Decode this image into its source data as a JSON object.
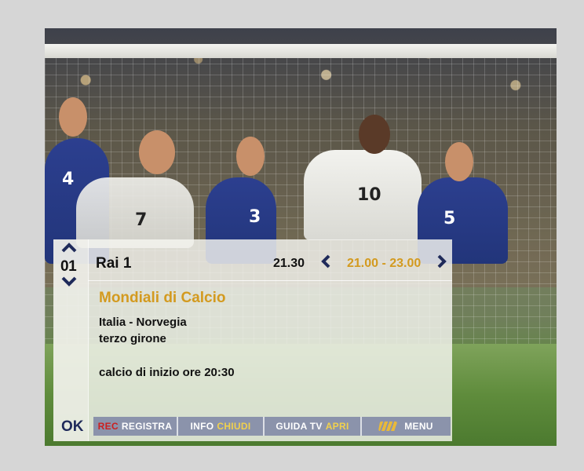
{
  "channel": {
    "number": "01",
    "name": "Rai 1"
  },
  "timing": {
    "current_time": "21.30",
    "slot": "21.00 - 23.00"
  },
  "program": {
    "title": "Mondiali di Calcio",
    "subtitle_1": "Italia - Norvegia",
    "subtitle_2": "terzo girone",
    "note": "calcio di inizio ore 20:30"
  },
  "controls": {
    "ok": "OK",
    "rec_key": "REC",
    "rec_label": "REGISTRA",
    "info_key": "INFO",
    "info_label": "CHIUDI",
    "guide_key": "GUIDA TV",
    "guide_label": "APRI",
    "menu_label": "MENU"
  },
  "players": {
    "jersey_left": "4",
    "jersey_mid": "3",
    "jersey_white": "10",
    "jersey_right": "5",
    "jersey_back": "7"
  },
  "icons": {
    "channel_up": "chevron-up-icon",
    "channel_down": "chevron-down-icon",
    "prev": "chevron-left-icon",
    "next": "chevron-right-icon",
    "menu": "menu-logo-icon"
  },
  "colors": {
    "accent": "#d39a1f",
    "nav": "#1f2a5a",
    "button_bg": "#8b93ab",
    "rec": "#cc1f1f"
  }
}
